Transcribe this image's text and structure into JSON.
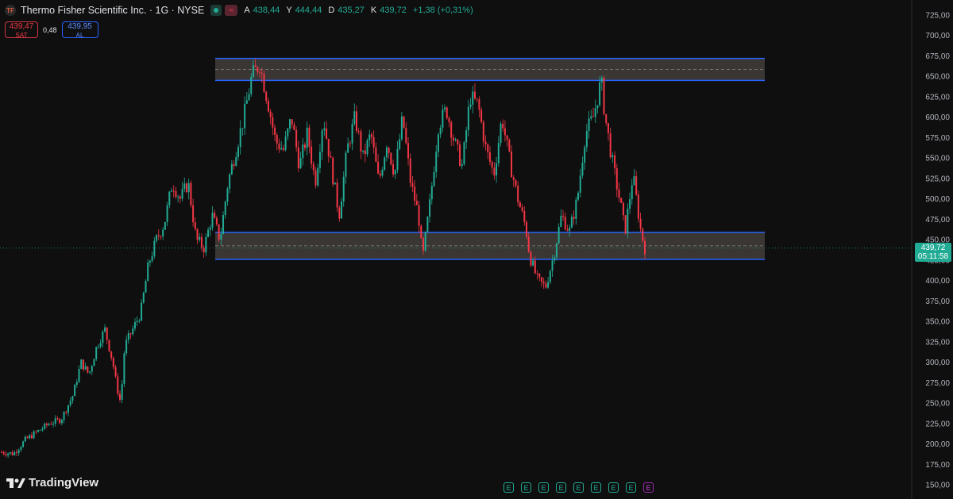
{
  "header": {
    "logo_text": "TF",
    "title": "Thermo Fisher Scientific Inc. · 1G · NYSE",
    "alert_icon_text": "≈",
    "ohlc": [
      {
        "label": "A",
        "value": "438,44"
      },
      {
        "label": "Y",
        "value": "444,44"
      },
      {
        "label": "D",
        "value": "435,27"
      },
      {
        "label": "K",
        "value": "439,72"
      }
    ],
    "change": "+1,38 (+0,31%)"
  },
  "trade": {
    "sell_price": "439,47",
    "sell_label": "SAT",
    "spread": "0,48",
    "buy_price": "439,95",
    "buy_label": "AL"
  },
  "price_tag": {
    "price": "439,72",
    "countdown": "05:11:58"
  },
  "brand": {
    "name": "TradingView"
  },
  "earnings_marker_text": "E",
  "colors": {
    "up": "#22ab94",
    "down": "#f23645",
    "zone_border": "#2962ff",
    "background": "#0f0f0f"
  },
  "chart_data": {
    "type": "candlestick",
    "title": "Thermo Fisher Scientific Inc. · 1G · NYSE",
    "ylim": [
      150,
      725
    ],
    "y_ticks": [
      "725,00",
      "700,00",
      "675,00",
      "650,00",
      "625,00",
      "600,00",
      "575,00",
      "550,00",
      "525,00",
      "500,00",
      "475,00",
      "450,00",
      "425,00",
      "400,00",
      "375,00",
      "350,00",
      "325,00",
      "300,00",
      "275,00",
      "250,00",
      "225,00",
      "200,00",
      "175,00",
      "150,00"
    ],
    "last_price": 439.72,
    "zones": [
      {
        "name": "resistance",
        "low": 645,
        "high": 672
      },
      {
        "name": "support",
        "low": 426,
        "high": 459
      }
    ],
    "price_path": [
      [
        0,
        190
      ],
      [
        3,
        188
      ],
      [
        6,
        205
      ],
      [
        9,
        215
      ],
      [
        12,
        225
      ],
      [
        15,
        230
      ],
      [
        18,
        260
      ],
      [
        20,
        300
      ],
      [
        22,
        285
      ],
      [
        24,
        320
      ],
      [
        26,
        340
      ],
      [
        28,
        300
      ],
      [
        29,
        270
      ],
      [
        30,
        250
      ],
      [
        31,
        320
      ],
      [
        33,
        340
      ],
      [
        35,
        360
      ],
      [
        37,
        420
      ],
      [
        39,
        450
      ],
      [
        41,
        470
      ],
      [
        43,
        520
      ],
      [
        45,
        500
      ],
      [
        47,
        520
      ],
      [
        49,
        450
      ],
      [
        51,
        440
      ],
      [
        53,
        480
      ],
      [
        55,
        450
      ],
      [
        57,
        520
      ],
      [
        59,
        560
      ],
      [
        61,
        600
      ],
      [
        63,
        650
      ],
      [
        65,
        665
      ],
      [
        67,
        620
      ],
      [
        69,
        570
      ],
      [
        71,
        560
      ],
      [
        73,
        600
      ],
      [
        75,
        540
      ],
      [
        77,
        580
      ],
      [
        79,
        520
      ],
      [
        81,
        600
      ],
      [
        83,
        540
      ],
      [
        85,
        480
      ],
      [
        87,
        560
      ],
      [
        89,
        600
      ],
      [
        91,
        550
      ],
      [
        93,
        580
      ],
      [
        95,
        520
      ],
      [
        97,
        570
      ],
      [
        99,
        530
      ],
      [
        101,
        600
      ],
      [
        103,
        520
      ],
      [
        105,
        480
      ],
      [
        106,
        425
      ],
      [
        108,
        500
      ],
      [
        110,
        590
      ],
      [
        112,
        610
      ],
      [
        114,
        570
      ],
      [
        116,
        540
      ],
      [
        118,
        625
      ],
      [
        120,
        615
      ],
      [
        122,
        560
      ],
      [
        124,
        530
      ],
      [
        126,
        600
      ],
      [
        128,
        545
      ],
      [
        130,
        500
      ],
      [
        132,
        465
      ],
      [
        133,
        430
      ],
      [
        135,
        400
      ],
      [
        137,
        392
      ],
      [
        139,
        430
      ],
      [
        141,
        480
      ],
      [
        143,
        460
      ],
      [
        145,
        500
      ],
      [
        147,
        580
      ],
      [
        149,
        600
      ],
      [
        151,
        645
      ],
      [
        152,
        600
      ],
      [
        154,
        540
      ],
      [
        156,
        490
      ],
      [
        157,
        460
      ],
      [
        159,
        530
      ],
      [
        161,
        460
      ],
      [
        162,
        440
      ]
    ],
    "earnings_markers": 9
  }
}
